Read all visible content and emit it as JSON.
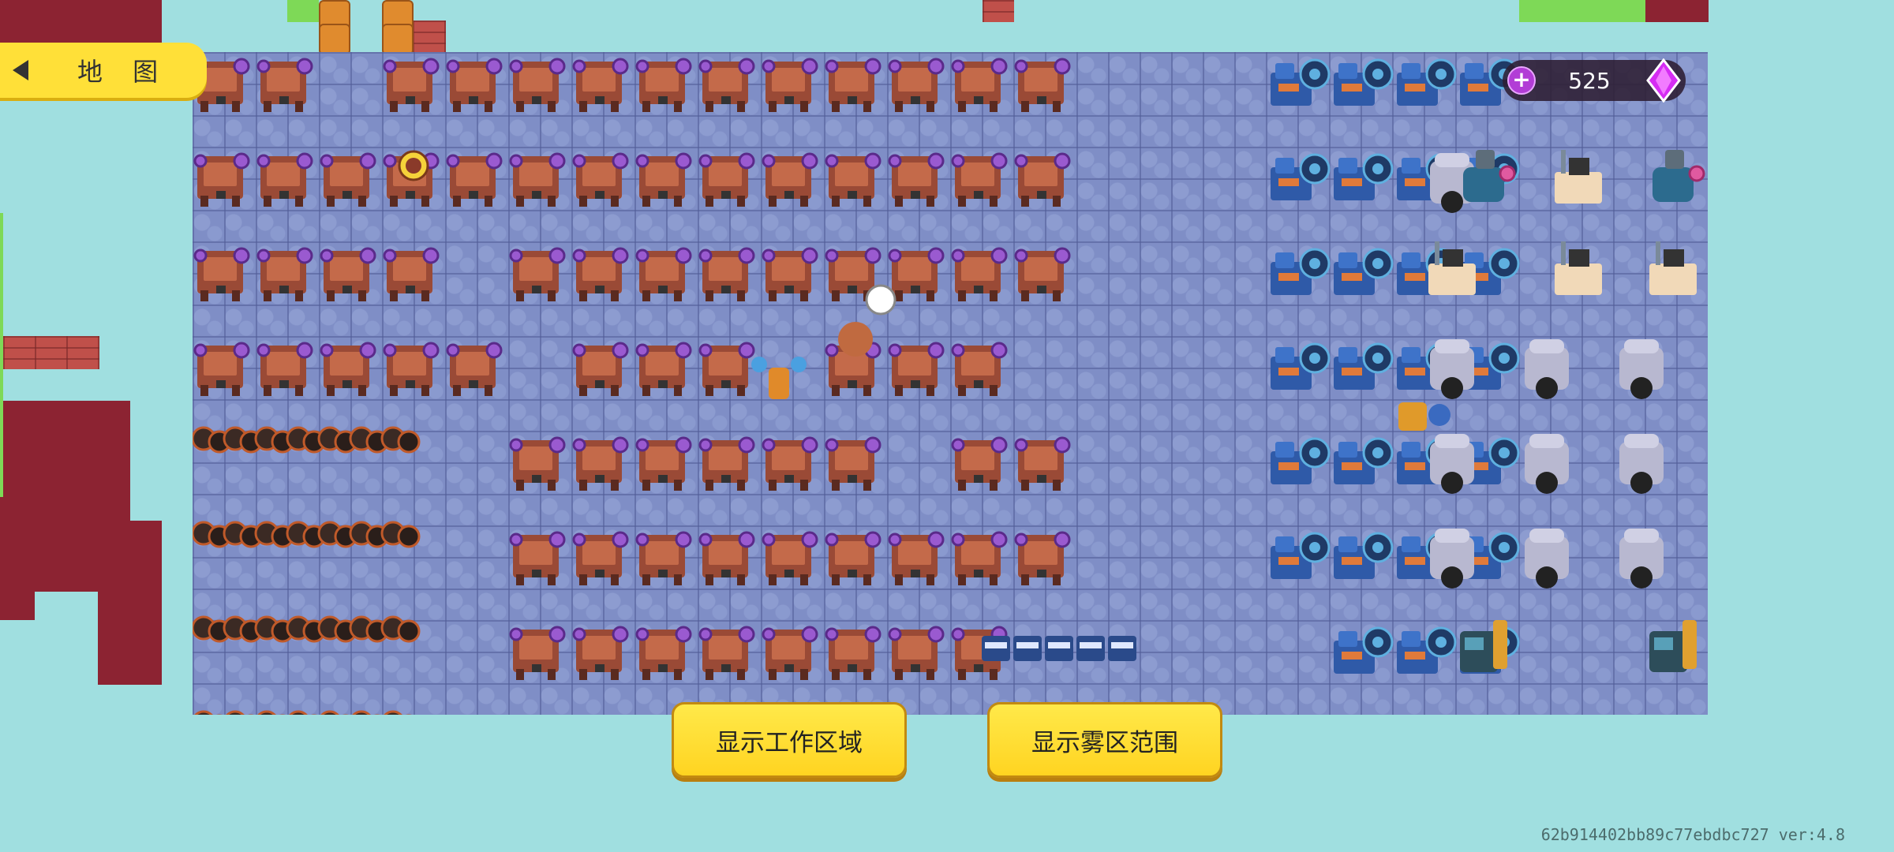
{
  "hud": {
    "map_button_label": "地 图",
    "back_icon": "triangle-left-icon",
    "currency_value": "525",
    "currency_add_icon": "plus-icon",
    "currency_gem_icon": "purple-gem-icon"
  },
  "buttons": {
    "show_work_area": "显示工作区域",
    "show_fog_area": "显示雾区范围"
  },
  "footer": {
    "version_text": "62b914402bb89c77ebdbc727 ver:4.8"
  },
  "colors": {
    "accent_yellow": "#ffe038",
    "floor": "#7f8ec6",
    "background": "#a0dfe0",
    "wall": "#8c2332"
  }
}
